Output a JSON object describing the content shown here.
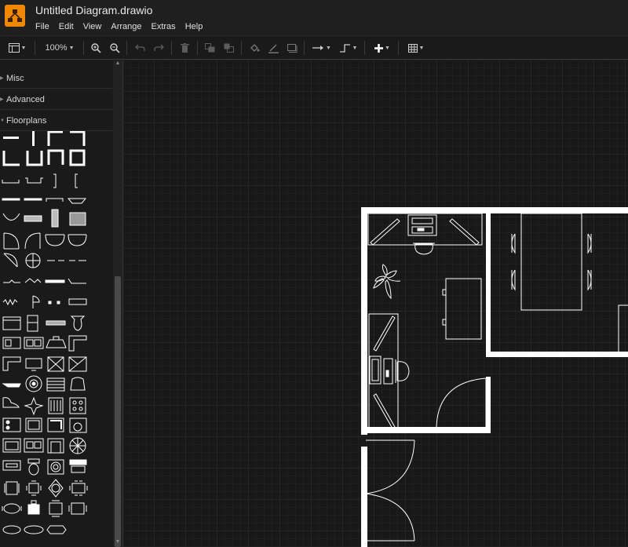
{
  "window": {
    "title": "Untitled Diagram.drawio",
    "accent": "#f08705"
  },
  "menu": [
    "File",
    "Edit",
    "View",
    "Arrange",
    "Extras",
    "Help"
  ],
  "toolbar": {
    "zoom": "100%"
  },
  "sidebar": {
    "sections": [
      "Misc",
      "Advanced",
      "Floorplans"
    ]
  },
  "icons": [
    "format-panel-icon",
    "zoom-in-icon",
    "zoom-out-icon",
    "undo-icon",
    "redo-icon",
    "delete-icon",
    "to-front-icon",
    "to-back-icon",
    "fill-color-icon",
    "line-color-icon",
    "shadow-icon",
    "connection-icon",
    "waypoints-icon",
    "insert-icon",
    "table-icon"
  ],
  "colors": {
    "canvas": "#181818",
    "wall": "#ffffff",
    "panel": "#1a1a1a"
  }
}
